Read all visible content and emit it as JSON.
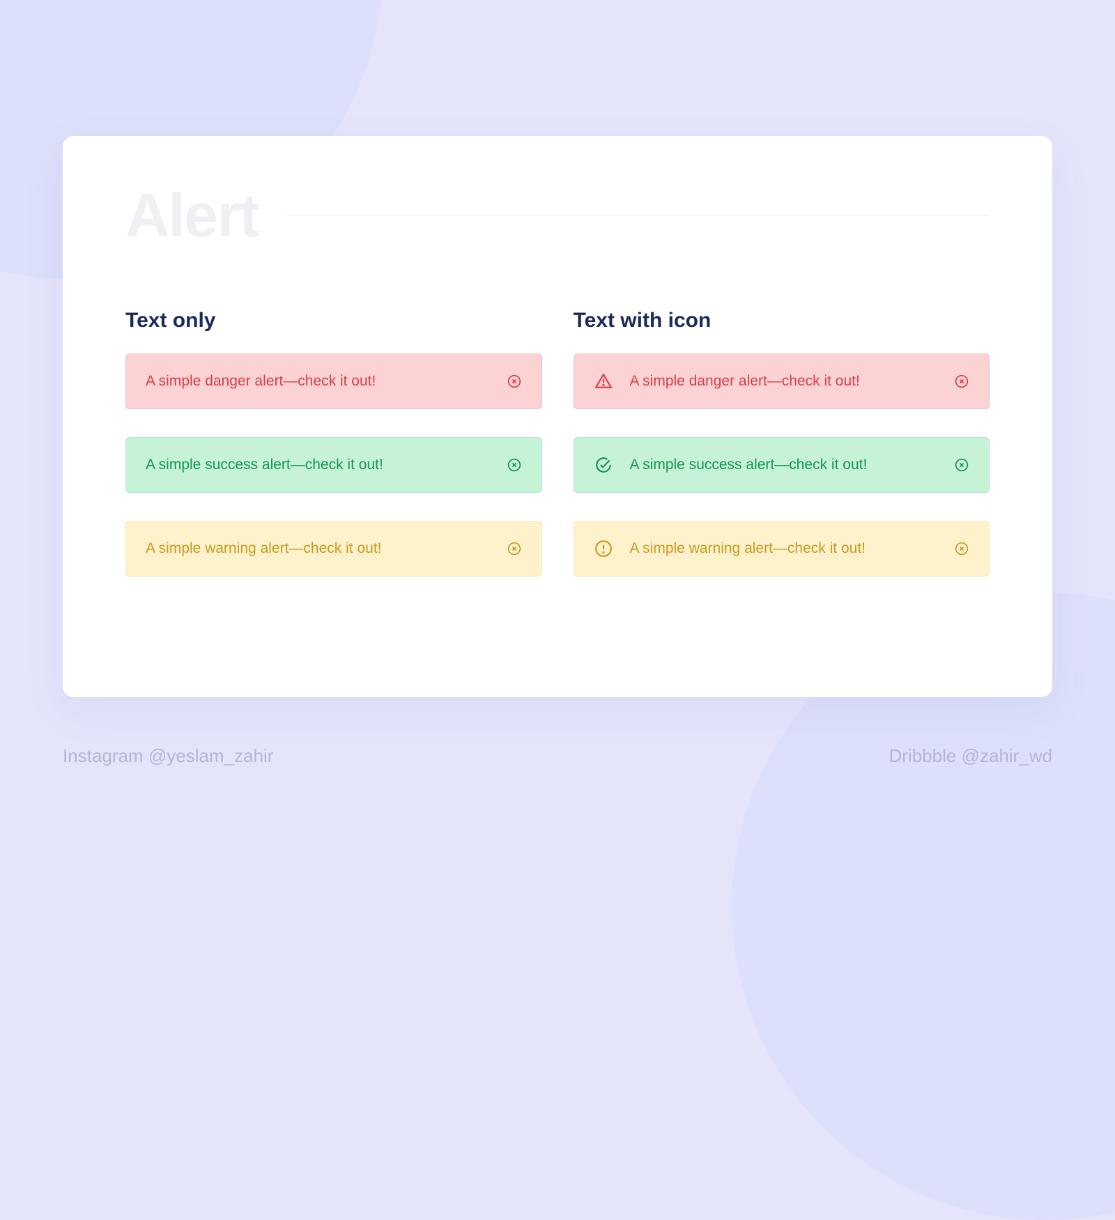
{
  "title": "Alert",
  "sections": {
    "text_only": {
      "label": "Text only",
      "alerts": {
        "danger": "A simple danger alert—check it out!",
        "success": "A simple success alert—check it out!",
        "warning": "A simple warning alert—check it out!"
      }
    },
    "text_with_icon": {
      "label": "Text with icon",
      "alerts": {
        "danger": "A simple danger alert—check it out!",
        "success": "A simple success alert—check it out!",
        "warning": "A simple warning alert—check it out!"
      }
    }
  },
  "footer": {
    "instagram": "Instagram @yeslam_zahir",
    "dribbble": "Dribbble @zahir_wd"
  },
  "colors": {
    "danger": {
      "bg": "#FBD3D4",
      "border": "#F5BDBE",
      "fg": "#D93E48"
    },
    "success": {
      "bg": "#C6F2D7",
      "border": "#B0E9C6",
      "fg": "#159553"
    },
    "warning": {
      "bg": "#FDF2CB",
      "border": "#F7E7AE",
      "fg": "#C99A1E"
    }
  }
}
